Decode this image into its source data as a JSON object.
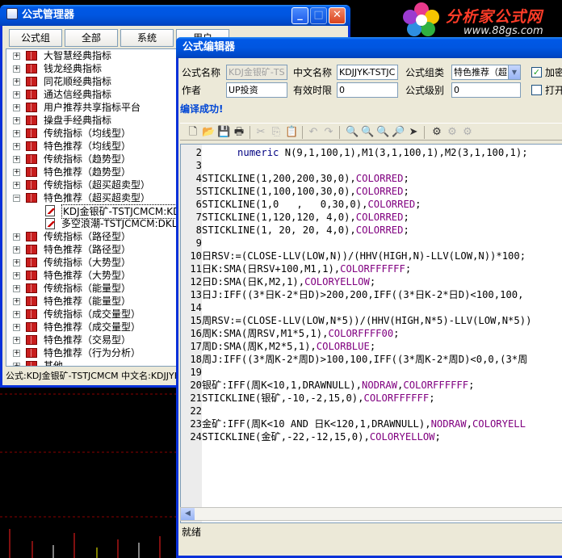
{
  "site_logo": {
    "title": "分析家公式网",
    "url": "www.88gs.com"
  },
  "manager": {
    "title": "公式管理器",
    "tabs": [
      "公式组",
      "全部",
      "系统",
      "用户"
    ],
    "tree": [
      {
        "label": "大智慧经典指标",
        "expanded": false
      },
      {
        "label": "钱龙经典指标",
        "expanded": false
      },
      {
        "label": "同花顺经典指标",
        "expanded": false
      },
      {
        "label": "通达信经典指标",
        "expanded": false
      },
      {
        "label": "用户推荐共享指标平台",
        "expanded": false
      },
      {
        "label": "操盘手经典指标",
        "expanded": false
      },
      {
        "label": "传统指标（均线型）",
        "expanded": false
      },
      {
        "label": "特色推荐（均线型）",
        "expanded": false
      },
      {
        "label": "传统指标（趋势型）",
        "expanded": false
      },
      {
        "label": "特色推荐（趋势型）",
        "expanded": false
      },
      {
        "label": "传统指标（超买超卖型）",
        "expanded": false
      },
      {
        "label": "特色推荐（超买超卖型）",
        "expanded": true,
        "children": [
          {
            "label": "KDJ金银矿-TSTJCMCM:KDJJYK-TS",
            "selected": true
          },
          {
            "label": "多空浪潮-TSTJCMCM:DKLC-TS",
            "selected": false
          }
        ]
      },
      {
        "label": "传统指标（路径型）",
        "expanded": false
      },
      {
        "label": "特色推荐（路径型）",
        "expanded": false
      },
      {
        "label": "传统指标（大势型）",
        "expanded": false
      },
      {
        "label": "特色推荐（大势型）",
        "expanded": false
      },
      {
        "label": "传统指标（能量型）",
        "expanded": false
      },
      {
        "label": "特色推荐（能量型）",
        "expanded": false
      },
      {
        "label": "传统指标（成交量型）",
        "expanded": false
      },
      {
        "label": "特色推荐（成交量型）",
        "expanded": false
      },
      {
        "label": "特色推荐（交易型）",
        "expanded": false
      },
      {
        "label": "特色推荐（行为分析）",
        "expanded": false
      },
      {
        "label": "其他",
        "expanded": false
      }
    ],
    "status": "公式:KDJ金银矿-TSTJCMCM 中文名:KDJJYK"
  },
  "editor": {
    "title": "公式编辑器",
    "fields": {
      "name_label": "公式名称",
      "name_value": "KDJ金银矿-TS",
      "cn_label": "中文名称",
      "cn_value": "KDJJYK-TSTJC",
      "group_label": "公式组类",
      "group_value": "特色推荐（超",
      "encrypt_label": "加密",
      "author_label": "作者",
      "author_value": "UP投资",
      "valid_label": "有效时限",
      "valid_value": "0",
      "level_label": "公式级别",
      "level_value": "0",
      "open_label": "打开"
    },
    "encrypt_checked": true,
    "open_checked": false,
    "compile_status": "编译成功!",
    "status_bar": "就绪",
    "code_lines": [
      {
        "n": "2",
        "html": "      numeric N(9,1,100,1),M1(3,1,100,1),M2(3,1,100,1);",
        "parts": [
          [
            "f",
            "      numeric"
          ],
          [
            "k",
            " N(9,1,100,1),M1(3,1,100,1),M2(3,1,100,1);"
          ]
        ]
      },
      {
        "n": "3",
        "parts": []
      },
      {
        "n": "4",
        "parts": [
          [
            "k",
            "STICKLINE(1,200,200,30,0),"
          ],
          [
            "c",
            "COLORRED"
          ],
          [
            "k",
            ";"
          ]
        ]
      },
      {
        "n": "5",
        "parts": [
          [
            "k",
            "STICKLINE(1,100,100,30,0),"
          ],
          [
            "c",
            "COLORRED"
          ],
          [
            "k",
            ";"
          ]
        ]
      },
      {
        "n": "6",
        "parts": [
          [
            "k",
            "STICKLINE(1,0   ,   0,30,0),"
          ],
          [
            "c",
            "COLORRED"
          ],
          [
            "k",
            ";"
          ]
        ]
      },
      {
        "n": "7",
        "parts": [
          [
            "k",
            "STICKLINE(1,120,120, 4,0),"
          ],
          [
            "c",
            "COLORRED"
          ],
          [
            "k",
            ";"
          ]
        ]
      },
      {
        "n": "8",
        "parts": [
          [
            "k",
            "STICKLINE(1, 20, 20, 4,0),"
          ],
          [
            "c",
            "COLORRED"
          ],
          [
            "k",
            ";"
          ]
        ]
      },
      {
        "n": "9",
        "parts": []
      },
      {
        "n": "10",
        "parts": [
          [
            "k",
            "日RSV:=(CLOSE-LLV(LOW,N))/(HHV(HIGH,N)-LLV(LOW,N))*100;"
          ]
        ]
      },
      {
        "n": "11",
        "parts": [
          [
            "k",
            "日K:SMA(日RSV+100,M1,1),"
          ],
          [
            "c",
            "COLORFFFFFF"
          ],
          [
            "k",
            ";"
          ]
        ]
      },
      {
        "n": "12",
        "parts": [
          [
            "k",
            "日D:SMA(日K,M2,1),"
          ],
          [
            "c",
            "COLORYELLOW"
          ],
          [
            "k",
            ";"
          ]
        ]
      },
      {
        "n": "13",
        "parts": [
          [
            "k",
            "日J:IFF((3*日K-2*日D)>200,200,IFF((3*日K-2*日D)<100,100,"
          ]
        ]
      },
      {
        "n": "14",
        "parts": []
      },
      {
        "n": "15",
        "parts": [
          [
            "k",
            "周RSV:=(CLOSE-LLV(LOW,N*5))/(HHV(HIGH,N*5)-LLV(LOW,N*5))"
          ]
        ]
      },
      {
        "n": "16",
        "parts": [
          [
            "k",
            "周K:SMA(周RSV,M1*5,1),"
          ],
          [
            "c",
            "COLORFFFF00"
          ],
          [
            "k",
            ";"
          ]
        ]
      },
      {
        "n": "17",
        "parts": [
          [
            "k",
            "周D:SMA(周K,M2*5,1),"
          ],
          [
            "c",
            "COLORBLUE"
          ],
          [
            "k",
            ";"
          ]
        ]
      },
      {
        "n": "18",
        "parts": [
          [
            "k",
            "周J:IFF((3*周K-2*周D)>100,100,IFF((3*周K-2*周D)<0,0,(3*周"
          ]
        ]
      },
      {
        "n": "19",
        "parts": []
      },
      {
        "n": "20",
        "parts": [
          [
            "k",
            "银矿:IFF(周K<10,1,DRAWNULL),"
          ],
          [
            "c",
            "NODRAW"
          ],
          [
            "k",
            ","
          ],
          [
            "c",
            "COLORFFFFFF"
          ],
          [
            "k",
            ";"
          ]
        ]
      },
      {
        "n": "21",
        "parts": [
          [
            "k",
            "STICKLINE(银矿,-10,-2,15,0),"
          ],
          [
            "c",
            "COLORFFFFFF"
          ],
          [
            "k",
            ";"
          ]
        ]
      },
      {
        "n": "22",
        "parts": []
      },
      {
        "n": "23",
        "parts": [
          [
            "k",
            "金矿:IFF(周K<10 AND 日K<120,1,DRAWNULL),"
          ],
          [
            "c",
            "NODRAW"
          ],
          [
            "k",
            ","
          ],
          [
            "c",
            "COLORYELL"
          ]
        ]
      },
      {
        "n": "24",
        "parts": [
          [
            "k",
            "STICKLINE(金矿,-22,-12,15,0),"
          ],
          [
            "c",
            "COLORYELLOW"
          ],
          [
            "k",
            ";"
          ]
        ]
      }
    ]
  }
}
